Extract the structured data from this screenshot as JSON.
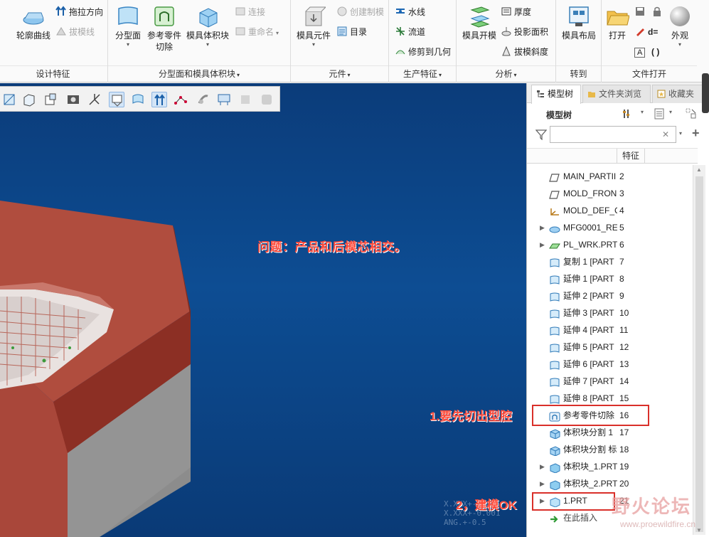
{
  "ribbon": {
    "groups": {
      "design": {
        "label": "设计特征",
        "big": {
          "contour": "轮廓曲线"
        },
        "small": {
          "pull_direction": "拖拉方向",
          "draft_line": "拔模线"
        }
      },
      "parting": {
        "label": "分型面和模具体积块",
        "big": {
          "parting_surface": "分型面",
          "ref_part_cut_1": "参考零件",
          "ref_part_cut_2": "切除",
          "mold_volume": "模具体积块"
        },
        "small": {
          "connect": "连接",
          "rename": "重命名"
        }
      },
      "component": {
        "label": "元件",
        "big": {
          "mold_component": "模具元件"
        },
        "small": {
          "create_casting": "创建制模",
          "catalog": "目录"
        }
      },
      "production": {
        "label": "生产特征",
        "small": {
          "waterline": "水线",
          "runner": "流道",
          "trim_geometry": "修剪到几何"
        }
      },
      "analysis": {
        "label": "分析",
        "big": {
          "mold_open": "模具开模"
        },
        "small": {
          "thickness": "厚度",
          "projected_area": "投影面积",
          "draft_slope": "拔模斜度"
        }
      },
      "goto": {
        "label": "转到",
        "big": {
          "mold_layout": "模具布局"
        }
      },
      "file_open": {
        "label": "文件打开",
        "big": {
          "open": "打开",
          "appearance": "外观"
        },
        "small": {
          "d_eq": "d=",
          "brackets": "( )",
          "a_box": "A"
        }
      }
    }
  },
  "viewport": {
    "question": "问题：产品和后模芯相交。",
    "note1": "1.要先切出型腔",
    "note2": "2，建模OK",
    "coord_readout": "X.XXX+-0.01\nX.XXX+-0.001\nANG.+-0.5"
  },
  "panel": {
    "tabs": [
      "模型树",
      "文件夹浏览",
      "收藏夹"
    ],
    "title": "模型树",
    "search": {
      "value": "",
      "placeholder": ""
    },
    "column_feature": "特征",
    "rows": [
      {
        "name": "MAIN_PARTII",
        "num": "2",
        "icon": "plane-icon",
        "expand": false
      },
      {
        "name": "MOLD_FRON",
        "num": "3",
        "icon": "plane-icon",
        "expand": false
      },
      {
        "name": "MOLD_DEF_C",
        "num": "4",
        "icon": "csys-icon",
        "expand": false
      },
      {
        "name": "MFG0001_RE",
        "num": "5",
        "icon": "reference-part-icon",
        "expand": true
      },
      {
        "name": "PL_WRK.PRT",
        "num": "6",
        "icon": "workpiece-icon",
        "expand": true
      },
      {
        "name": "复制 1 [PART",
        "num": "7",
        "icon": "surface-icon",
        "expand": false
      },
      {
        "name": "延伸 1 [PART",
        "num": "8",
        "icon": "surface-icon",
        "expand": false
      },
      {
        "name": "延伸 2 [PART",
        "num": "9",
        "icon": "surface-icon",
        "expand": false
      },
      {
        "name": "延伸 3 [PART",
        "num": "10",
        "icon": "surface-icon",
        "expand": false
      },
      {
        "name": "延伸 4 [PART",
        "num": "11",
        "icon": "surface-icon",
        "expand": false
      },
      {
        "name": "延伸 5 [PART",
        "num": "12",
        "icon": "surface-icon",
        "expand": false
      },
      {
        "name": "延伸 6 [PART",
        "num": "13",
        "icon": "surface-icon",
        "expand": false
      },
      {
        "name": "延伸 7 [PART",
        "num": "14",
        "icon": "surface-icon",
        "expand": false
      },
      {
        "name": "延伸 8 [PART",
        "num": "15",
        "icon": "surface-icon",
        "expand": false
      },
      {
        "name": "参考零件切除",
        "num": "16",
        "icon": "cut-icon",
        "expand": false
      },
      {
        "name": "体积块分割 1",
        "num": "17",
        "icon": "volume-split-icon",
        "expand": false
      },
      {
        "name": "体积块分割 标",
        "num": "18",
        "icon": "volume-split-icon",
        "expand": false
      },
      {
        "name": "体积块_1.PRT",
        "num": "19",
        "icon": "volume-icon",
        "expand": true
      },
      {
        "name": "体积块_2.PRT",
        "num": "20",
        "icon": "volume-icon",
        "expand": true
      },
      {
        "name": "1.PRT",
        "num": "21",
        "icon": "part-icon",
        "expand": true
      },
      {
        "name": "在此插入",
        "num": "",
        "icon": "insert-arrow-icon",
        "expand": false
      }
    ]
  },
  "watermark": {
    "text": "野火论坛",
    "url": "www.proewildfire.cn"
  },
  "colors": {
    "annotation_red": "#ff4c3c",
    "box_red": "#d9302a",
    "model_brown": "#b24a3a",
    "background_blue": "#0d4d93"
  }
}
